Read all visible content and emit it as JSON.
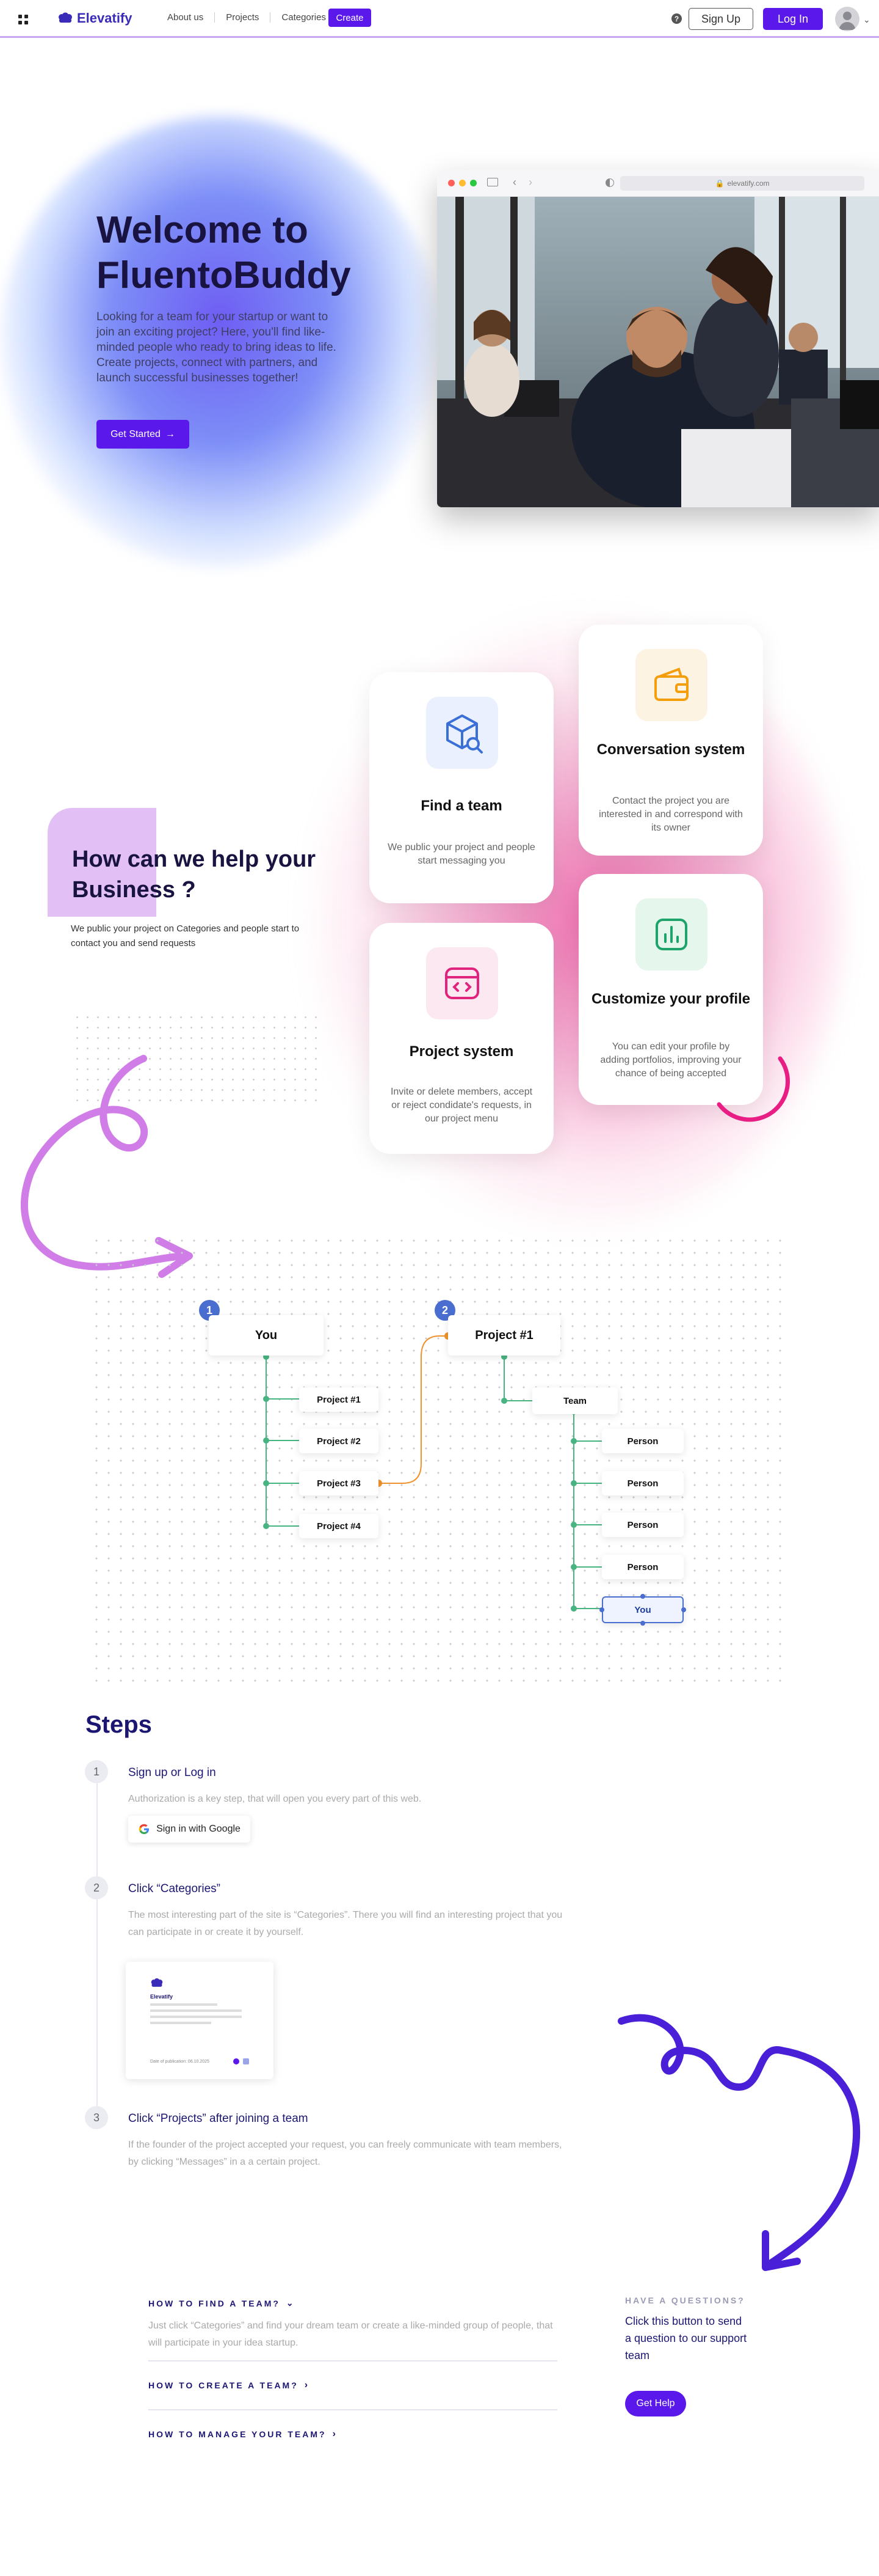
{
  "nav": {
    "brand": "Elevatify",
    "links": [
      "About us",
      "Projects",
      "Categories"
    ],
    "create_label": "Create",
    "help_glyph": "?",
    "signup_label": "Sign Up",
    "login_label": "Log In"
  },
  "hero": {
    "title": "Welcome to FluentoBuddy",
    "text": "Looking for a team for your startup or want to join an exciting project? Here, you'll find like-minded people who ready to bring ideas to life. Create projects, connect with partners, and launch successful businesses together!",
    "cta_label": "Get Started",
    "browser_url": "elevatify.com"
  },
  "help": {
    "title": "How can we help your Business ?",
    "text": "We public your project on Categories and people start to contact you and send requests",
    "cards": [
      {
        "title": "Find a team",
        "text": "We public your project and people start messaging you",
        "icon": "cube-search-icon",
        "color": "#3b6fd8"
      },
      {
        "title": "Conversation system",
        "text": "Contact the project you are interested in and correspond with its owner",
        "icon": "wallet-icon",
        "color": "#f59e0b"
      },
      {
        "title": "Project system",
        "text": "Invite or delete members, accept or reject condidate's requests, in our project menu",
        "icon": "code-window-icon",
        "color": "#e0247d"
      },
      {
        "title": "Customize your profile",
        "text": "You can edit your profile by adding portfolios, improving your chance of being accepted",
        "icon": "chart-icon",
        "color": "#1ea36a"
      }
    ]
  },
  "diagram": {
    "left": {
      "badge": "1",
      "root": "You",
      "children": [
        "Project #1",
        "Project #2",
        "Project #3",
        "Project #4"
      ]
    },
    "right": {
      "badge": "2",
      "root": "Project #1",
      "team": "Team",
      "members": [
        "Person",
        "Person",
        "Person",
        "Person",
        "You"
      ]
    }
  },
  "steps": {
    "title": "Steps",
    "items": [
      {
        "num": "1",
        "title": "Sign up or Log in",
        "text": "Authorization is a key step, that will open you every part of this web."
      },
      {
        "num": "2",
        "title": "Click “Categories”",
        "text": "The most interesting part of the site is “Categories”. There you will find an interesting project that you can participate in or create it by yourself."
      },
      {
        "num": "3",
        "title": "Click “Projects” after joining a team",
        "text": "If the founder of the project accepted your request, you can freely communicate with team members, by clicking “Messages” in a a certain project."
      }
    ],
    "google_label": "Sign in with Google",
    "mini_card": {
      "name": "Elevatify",
      "footer": "Date of publication: 06.10.2025"
    }
  },
  "faq": {
    "items": [
      {
        "q": "HOW TO FIND A TEAM?",
        "a": "Just click “Categories” and find your dream team or create a like-minded group of people, that will participate in your idea startup."
      },
      {
        "q": "HOW TO CREATE A TEAM?"
      },
      {
        "q": "HOW TO MANAGE YOUR TEAM?"
      }
    ],
    "question_label": "HAVE A QUESTIONS?",
    "question_text": "Click this button to send a question to our support team",
    "help_label": "Get Help"
  }
}
